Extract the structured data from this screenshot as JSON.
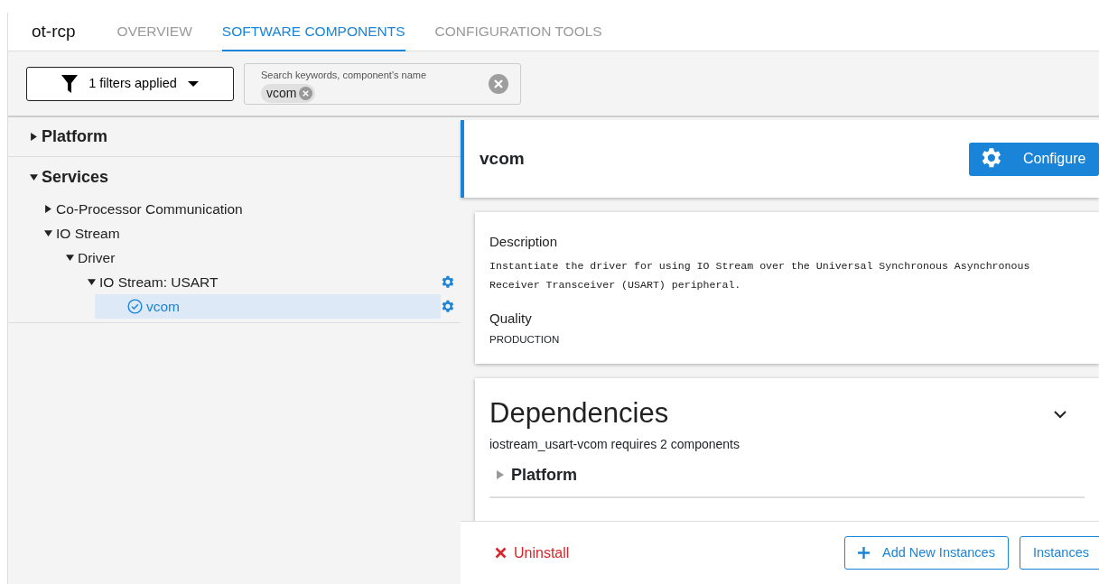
{
  "project": {
    "title": "ot-rcp"
  },
  "tabs": [
    {
      "label": "OVERVIEW",
      "selected": false
    },
    {
      "label": "SOFTWARE COMPONENTS",
      "selected": true
    },
    {
      "label": "CONFIGURATION TOOLS",
      "selected": false
    }
  ],
  "filter_button": {
    "label": "1 filters applied"
  },
  "search": {
    "placeholder": "Search keywords, component's name",
    "chips": [
      "vcom"
    ]
  },
  "tree": [
    {
      "label": "Platform",
      "expanded": false,
      "selected": false,
      "configurable": false,
      "installed": false
    },
    {
      "label": "Services",
      "expanded": true,
      "selected": false,
      "configurable": false,
      "installed": false,
      "children": [
        {
          "label": "Co-Processor Communication",
          "expanded": false,
          "selected": false,
          "configurable": false,
          "installed": false
        },
        {
          "label": "IO Stream",
          "expanded": true,
          "selected": false,
          "configurable": false,
          "installed": false,
          "children": [
            {
              "label": "Driver",
              "expanded": true,
              "selected": false,
              "configurable": false,
              "installed": false,
              "children": [
                {
                  "label": "IO Stream: USART",
                  "expanded": true,
                  "selected": false,
                  "configurable": true,
                  "installed": false,
                  "children": [
                    {
                      "label": "vcom",
                      "selected": true,
                      "configurable": true,
                      "installed": true
                    }
                  ]
                }
              ]
            }
          ]
        }
      ]
    }
  ],
  "detail": {
    "title": "vcom",
    "configure_button": "Configure",
    "description_label": "Description",
    "description": "Instantiate the driver for using IO Stream over the Universal Synchronous Asynchronous Receiver Transceiver (USART) peripheral.",
    "quality_label": "Quality",
    "quality": "PRODUCTION",
    "dependencies": {
      "title": "Dependencies",
      "expanded": true,
      "summary": "iostream_usart-vcom requires 2 components",
      "groups": [
        {
          "label": "Platform",
          "expanded": false
        }
      ]
    }
  },
  "footer": {
    "uninstall": "Uninstall",
    "add_instances": "Add New Instances",
    "instances": "Instances"
  }
}
